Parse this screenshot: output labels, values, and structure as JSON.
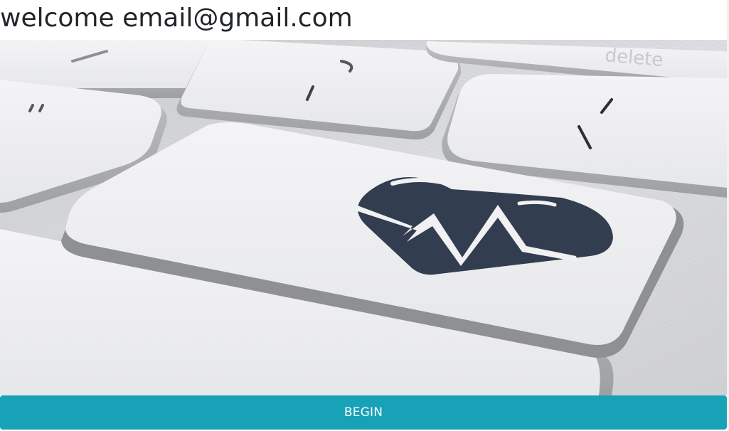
{
  "header": {
    "welcome_text": "welcome email@gmail.com"
  },
  "hero": {
    "image_subject": "keyboard-with-heart-key",
    "key_label": "delete",
    "icon_color": "#333d50"
  },
  "actions": {
    "begin_label": "BEGIN",
    "begin_color": "#17a2b8"
  }
}
